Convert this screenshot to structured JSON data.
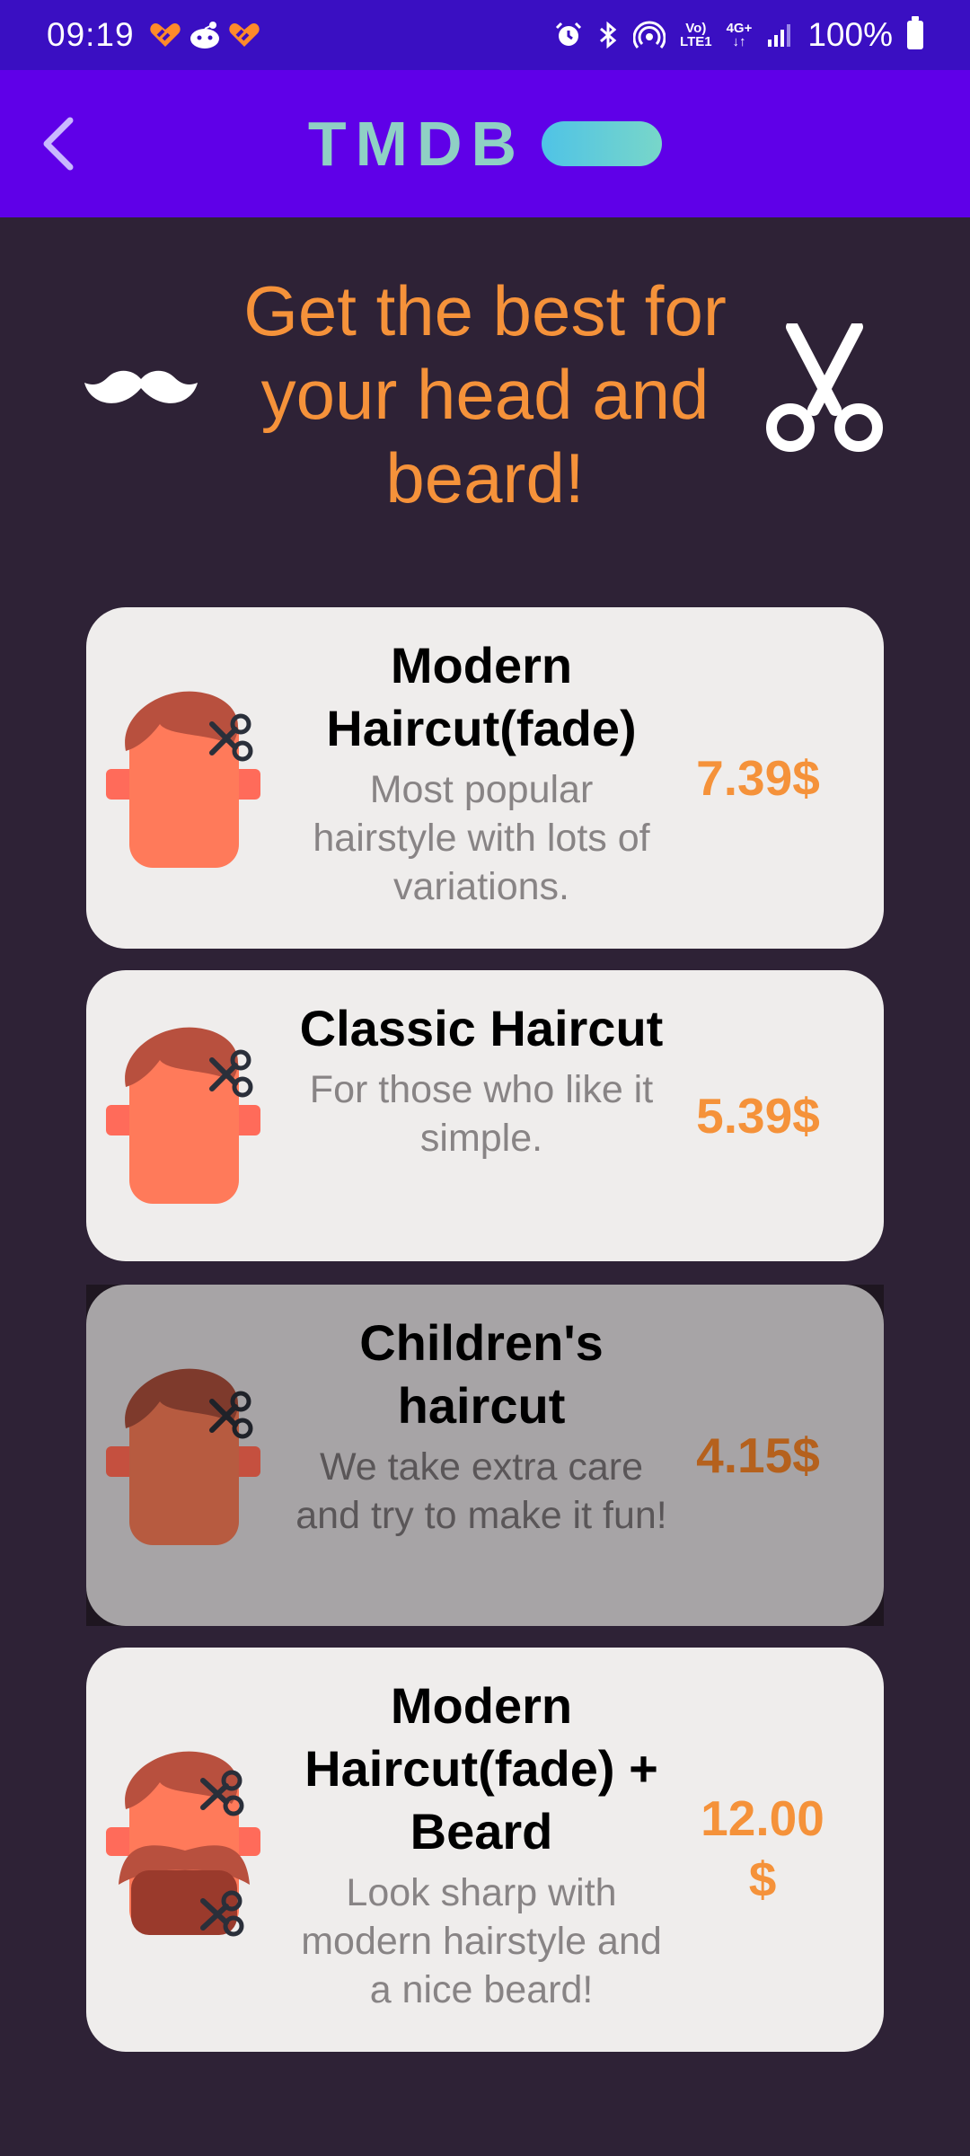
{
  "status_bar": {
    "time": "09:19",
    "net_label_top": "Vo)",
    "net_label_bottom": "LTE1",
    "net_type": "4G+",
    "battery": "100%"
  },
  "app_bar": {
    "logo_text": "TMDB"
  },
  "hero": {
    "title": "Get the best for your head and beard!"
  },
  "services": [
    {
      "title": "Modern Haircut(fade)",
      "description": "Most popular hairstyle with lots of variations.",
      "price": "7.39$"
    },
    {
      "title": "Classic Haircut",
      "description": "For those who like it simple.",
      "price": "5.39$"
    },
    {
      "title": "Children's haircut",
      "description": "We take extra care and try to make it fun!",
      "price": "4.15$"
    },
    {
      "title": "Modern Haircut(fade) + Beard",
      "description": "Look sharp with modern hairstyle and a nice beard!",
      "price": "12.00 $"
    }
  ],
  "colors": {
    "status_bar": "#3a0fc2",
    "app_bar": "#5f00e8",
    "background": "#2e2236",
    "accent": "#f5923a",
    "card": "#efedec"
  },
  "icons": [
    "back-arrow-icon",
    "mustache-icon",
    "scissors-icon",
    "haircut-head-icon",
    "beard-head-icon"
  ]
}
